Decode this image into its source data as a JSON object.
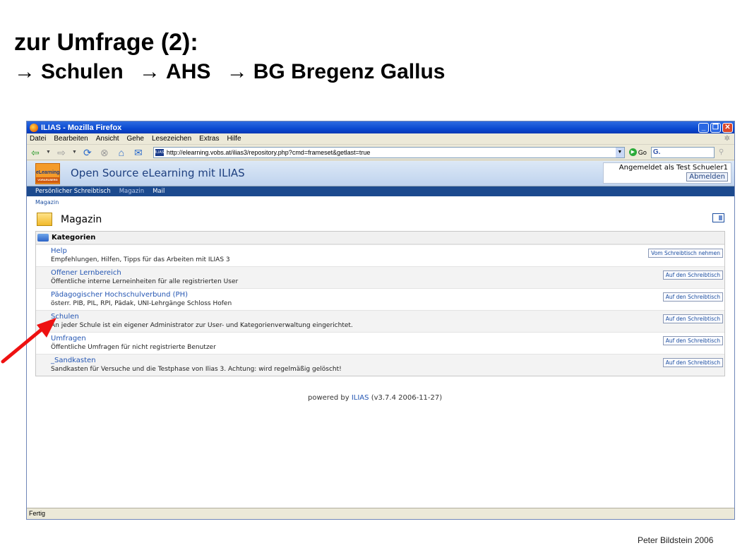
{
  "slide": {
    "title": "zur Umfrage (2):",
    "path": [
      {
        "arrow": "→",
        "label": "Schulen"
      },
      {
        "arrow": "→",
        "label": "AHS"
      },
      {
        "arrow": "→",
        "label": "BG Bregenz Gallus"
      }
    ],
    "footer": "Peter Bildstein 2006"
  },
  "browser": {
    "window_title": "ILIAS - Mozilla Firefox",
    "menu": [
      "Datei",
      "Bearbeiten",
      "Ansicht",
      "Gehe",
      "Lesezeichen",
      "Extras",
      "Hilfe"
    ],
    "url": "http://elearning.vobs.at/ilias3/repository.php?cmd=frameset&getlast=true",
    "go_label": "Go",
    "search_value": "G.",
    "status": "Fertig"
  },
  "ilias": {
    "logo_text": "eLearning",
    "logo_sub": "VORARLBERG",
    "site_title": "Open Source eLearning mit ILIAS",
    "login_text": "Angemeldet als Test Schueler1",
    "logout_label": "Abmelden",
    "nav": [
      "Persönlicher Schreibtisch",
      "Magazin",
      "Mail"
    ],
    "breadcrumb": "Magazin",
    "page_title": "Magazin",
    "section_title": "Kategorien",
    "categories": [
      {
        "name": "Help",
        "desc": "Empfehlungen, Hilfen, Tipps für das Arbeiten mit ILIAS 3",
        "action": "Vom Schreibtisch nehmen"
      },
      {
        "name": "Offener Lernbereich",
        "desc": "Öffentliche interne Lerneinheiten für alle registrierten User",
        "action": "Auf den Schreibtisch"
      },
      {
        "name": "Pädagogischer Hochschulverbund (PH)",
        "desc": "österr. PIB, PIL, RPI, Pädak, UNI-Lehrgänge Schloss Hofen",
        "action": "Auf den Schreibtisch"
      },
      {
        "name": "Schulen",
        "desc": "An jeder Schule ist ein eigener Administrator zur User- und Kategorienverwaltung eingerichtet.",
        "action": "Auf den Schreibtisch"
      },
      {
        "name": "Umfragen",
        "desc": "Öffentliche Umfragen für nicht registrierte Benutzer",
        "action": "Auf den Schreibtisch"
      },
      {
        "name": "_Sandkasten",
        "desc": "Sandkasten für Versuche und die Testphase von Ilias 3. Achtung: wird regelmäßig gelöscht!",
        "action": "Auf den Schreibtisch"
      }
    ],
    "powered_prefix": "powered by",
    "powered_link": "ILIAS",
    "powered_version": "(v3.7.4 2006-11-27)"
  },
  "colors": {
    "arrow": "#ee1111",
    "nav_bar": "#1c4a8e",
    "link": "#2456b3"
  }
}
